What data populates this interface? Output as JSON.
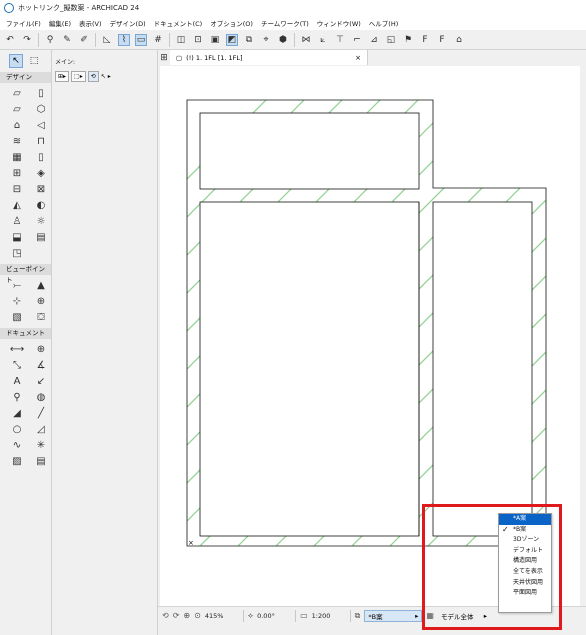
{
  "window": {
    "title": "ホットリンク_擬数案 - ARCHICAD 24"
  },
  "menu": [
    "ファイル(F)",
    "編集(E)",
    "表示(V)",
    "デザイン(D)",
    "ドキュメント(C)",
    "オプション(O)",
    "チームワーク(T)",
    "ウィンドウ(W)",
    "ヘルプ(H)"
  ],
  "toolbox": {
    "sections": [
      "デザイン",
      "ビューポイント",
      "ドキュメント"
    ]
  },
  "infobox": {
    "label": "メイン:"
  },
  "tab": {
    "label": "(!) 1. 1FL [1. 1FL]",
    "close": "×"
  },
  "status": {
    "zoom": "415%",
    "angle": "0.00°",
    "scale": "1:200",
    "layer_combo": "*B案",
    "model_view": "モデル全体"
  },
  "dropdown": {
    "options": [
      "*A案",
      "*B案",
      "3Dゾーン",
      "デフォルト",
      "構造図用",
      "全てを表示",
      "天井伏図用",
      "平面図用"
    ],
    "selected": "*A案",
    "checked": "*B案"
  },
  "colors": {
    "highlight": "#e0191c",
    "selection": "#0a64c8",
    "hatch": "#8fd18f"
  }
}
